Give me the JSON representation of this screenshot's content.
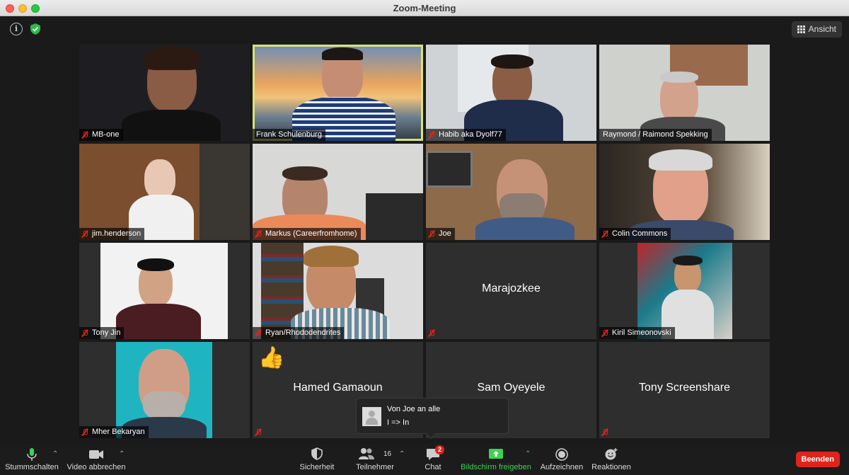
{
  "window": {
    "title": "Zoom-Meeting"
  },
  "topbar": {
    "view_label": "Ansicht"
  },
  "participants": [
    {
      "name": "MB-one",
      "muted": true,
      "video": true
    },
    {
      "name": "Frank Schulenburg",
      "muted": false,
      "video": true,
      "active_speaker": true
    },
    {
      "name": "Habib aka Dyolf77",
      "muted": true,
      "video": true
    },
    {
      "name": "Raymond / Raimond Spekking",
      "muted": false,
      "video": true
    },
    {
      "name": "jim.henderson",
      "muted": true,
      "video": true
    },
    {
      "name": "Markus (Careerfromhome)",
      "muted": true,
      "video": true
    },
    {
      "name": "Joe",
      "muted": true,
      "video": true
    },
    {
      "name": "Colin Commons",
      "muted": true,
      "video": true
    },
    {
      "name": "Tony Jin",
      "muted": true,
      "video": true
    },
    {
      "name": "Ryan/Rhododendrites",
      "muted": true,
      "video": true
    },
    {
      "name": "Marajozkee",
      "muted": true,
      "video": false
    },
    {
      "name": "Kiril Simeonovski",
      "muted": true,
      "video": true
    },
    {
      "name": "Mher Bekaryan",
      "muted": true,
      "video": true
    },
    {
      "name": "Hamed Gamaoun",
      "muted": true,
      "video": false,
      "reaction": "👍"
    },
    {
      "name": "Sam Oyeyele",
      "muted": false,
      "video": false
    },
    {
      "name": "Tony Screenshare",
      "muted": true,
      "video": false
    }
  ],
  "chat_popup": {
    "from": "Von Joe an alle",
    "message": "I => In"
  },
  "toolbar": {
    "mute_label": "Stummschalten",
    "video_label": "Video abbrechen",
    "security_label": "Sicherheit",
    "participants_label": "Teilnehmer",
    "participants_count": "16",
    "chat_label": "Chat",
    "chat_badge": "2",
    "share_label": "Bildschirm freigeben",
    "record_label": "Aufzeichnen",
    "reactions_label": "Reaktionen",
    "end_label": "Beenden"
  },
  "colors": {
    "active_speaker_border": "#d7e37a",
    "share_green": "#3fd153",
    "end_red": "#e0241b",
    "muted_red": "#e0241b"
  }
}
